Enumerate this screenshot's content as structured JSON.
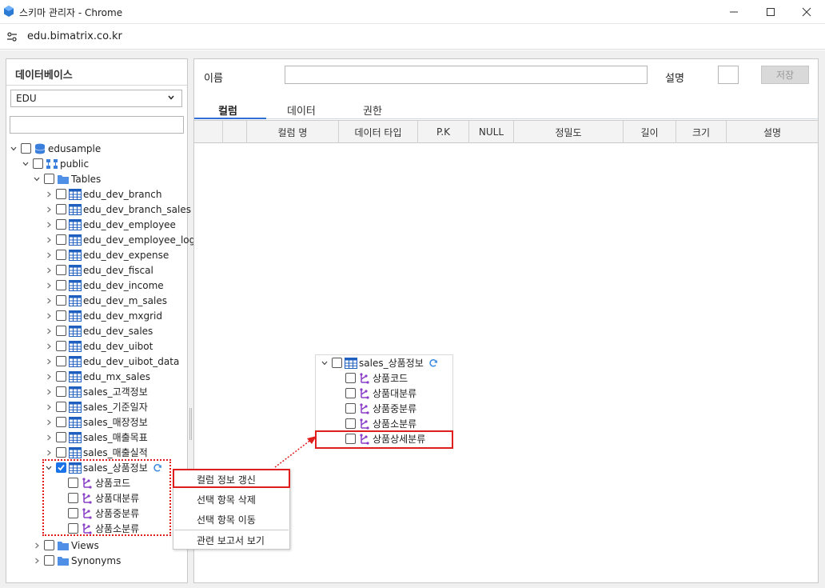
{
  "window": {
    "title": "스키마 관리자 - Chrome",
    "url": "edu.bimatrix.co.kr"
  },
  "left_panel": {
    "title": "데이터베이스",
    "db_select": "EDU",
    "tree": {
      "db": "edusample",
      "schema": "public",
      "tables_folder": "Tables",
      "tables": [
        "edu_dev_branch",
        "edu_dev_branch_sales",
        "edu_dev_employee",
        "edu_dev_employee_log",
        "edu_dev_expense",
        "edu_dev_fiscal",
        "edu_dev_income",
        "edu_dev_m_sales",
        "edu_dev_mxgrid",
        "edu_dev_sales",
        "edu_dev_uibot",
        "edu_dev_uibot_data",
        "edu_mx_sales",
        "sales_고객정보",
        "sales_기준일자",
        "sales_매장정보",
        "sales_매출목표",
        "sales_매출실적",
        "sales_상품정보"
      ],
      "expanded_table_columns": [
        "상품코드",
        "상품대분류",
        "상품중분류",
        "상품소분류"
      ],
      "views_folder": "Views",
      "synonyms_folder": "Synonyms"
    }
  },
  "right_panel": {
    "name_label": "이름",
    "desc_label": "설명",
    "save_label": "저장",
    "tabs": [
      "컬럼",
      "데이터",
      "권한"
    ],
    "grid_headers": [
      "컬럼 명",
      "데이터 타입",
      "P.K",
      "NULL",
      "정밀도",
      "길이",
      "크기",
      "설명"
    ]
  },
  "popup": {
    "table": "sales_상품정보",
    "columns": [
      "상품코드",
      "상품대분류",
      "상품중분류",
      "상품소분류",
      "상품상세분류"
    ]
  },
  "context_menu": {
    "items": [
      "컬럼 정보 갱신",
      "선택 항목 삭제",
      "선택 항목 이동",
      "관련 보고서 보기"
    ]
  },
  "colors": {
    "accent": "#2f6fd6",
    "highlight": "#e01e1e",
    "column_icon": "#8b3fc9"
  }
}
